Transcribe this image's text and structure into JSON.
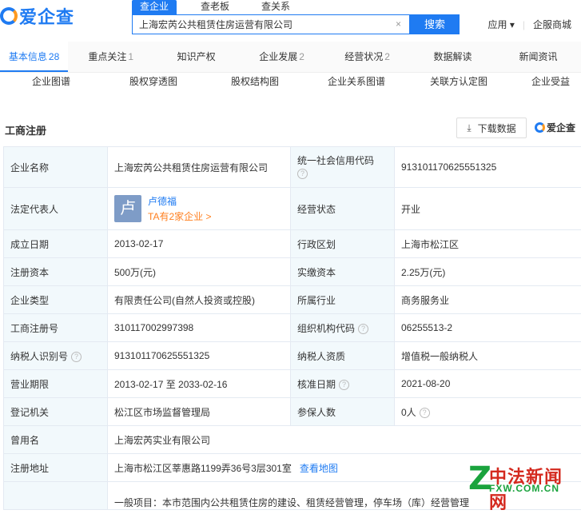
{
  "brand": {
    "name": "爱企查"
  },
  "search": {
    "tabs": [
      "查企业",
      "查老板",
      "查关系"
    ],
    "query": "上海宏芮公共租赁住房运营有限公司",
    "button": "搜索"
  },
  "header_links": {
    "apps": "应用 ▾",
    "service": "企服商城"
  },
  "nav": {
    "tabs": [
      {
        "label": "基本信息",
        "count": "28"
      },
      {
        "label": "重点关注",
        "count": "1"
      },
      {
        "label": "知识产权",
        "count": ""
      },
      {
        "label": "企业发展",
        "count": "2"
      },
      {
        "label": "经营状况",
        "count": "2"
      },
      {
        "label": "数据解读",
        "count": ""
      },
      {
        "label": "新闻资讯",
        "count": ""
      }
    ],
    "subtabs": [
      "企业图谱",
      "股权穿透图",
      "股权结构图",
      "企业关系图谱",
      "关联方认定图",
      "企业受益"
    ]
  },
  "section": {
    "title": "工商注册",
    "download": "下载数据",
    "brand": "爱企查"
  },
  "registration": {
    "company_name_label": "企业名称",
    "company_name": "上海宏芮公共租赁住房运营有限公司",
    "credit_code_label": "统一社会信用代码",
    "credit_code": "913101170625551325",
    "legal_rep_label": "法定代表人",
    "legal_rep_avatar": "卢",
    "legal_rep": "卢德福",
    "legal_rep_companies": "TA有2家企业 >",
    "status_label": "经营状态",
    "status": "开业",
    "founded_label": "成立日期",
    "founded": "2013-02-17",
    "district_label": "行政区划",
    "district": "上海市松江区",
    "reg_capital_label": "注册资本",
    "reg_capital": "500万(元)",
    "paid_capital_label": "实缴资本",
    "paid_capital": "2.25万(元)",
    "type_label": "企业类型",
    "type": "有限责任公司(自然人投资或控股)",
    "industry_label": "所属行业",
    "industry": "商务服务业",
    "reg_no_label": "工商注册号",
    "reg_no": "310117002997398",
    "org_code_label": "组织机构代码",
    "org_code": "06255513-2",
    "taxpayer_id_label": "纳税人识别号",
    "taxpayer_id": "913101170625551325",
    "taxpayer_type_label": "纳税人资质",
    "taxpayer_type": "增值税一般纳税人",
    "term_label": "营业期限",
    "term": "2013-02-17 至 2033-02-16",
    "approval_label": "核准日期",
    "approval": "2021-08-20",
    "authority_label": "登记机关",
    "authority": "松江区市场监督管理局",
    "insured_label": "参保人数",
    "insured": "0人",
    "former_name_label": "曾用名",
    "former_name": "上海宏芮实业有限公司",
    "address_label": "注册地址",
    "address": "上海市松江区莘惠路1199弄36号3层301室",
    "map_link": "查看地图",
    "scope_text": "一般项目：本市范围内公共租赁住房的建设、租赁经营管理，停车场（库）经营管理"
  },
  "watermark": {
    "letter": "Z",
    "cn": "中法新闻网",
    "en": "FXW.COM.CN"
  }
}
